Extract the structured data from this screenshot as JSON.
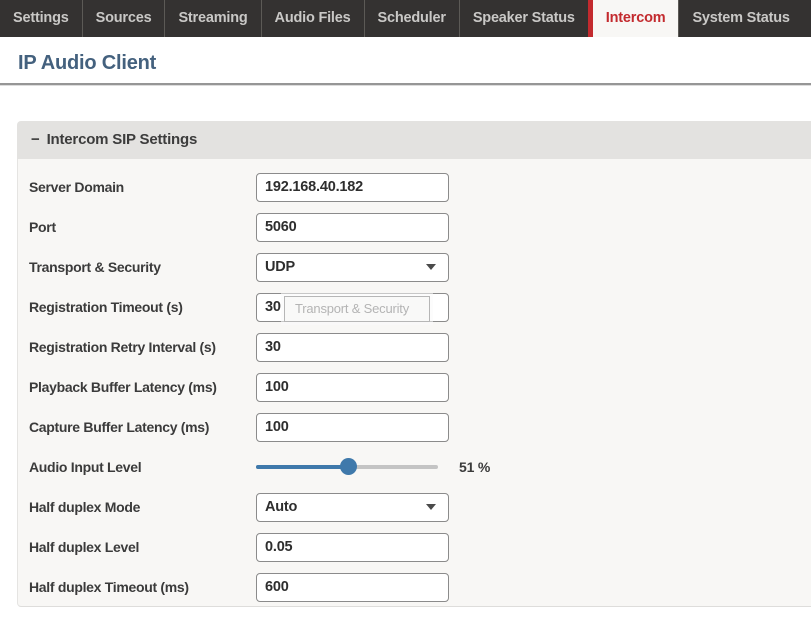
{
  "tabs": [
    {
      "label": "Settings",
      "active": false
    },
    {
      "label": "Sources",
      "active": false
    },
    {
      "label": "Streaming",
      "active": false
    },
    {
      "label": "Audio Files",
      "active": false
    },
    {
      "label": "Scheduler",
      "active": false
    },
    {
      "label": "Speaker Status",
      "active": false
    },
    {
      "label": "Intercom",
      "active": true
    },
    {
      "label": "System Status",
      "active": false
    }
  ],
  "page": {
    "title": "IP Audio Client"
  },
  "panel": {
    "collapse_icon": "−",
    "title": "Intercom SIP Settings",
    "fields": [
      {
        "label": "Server Domain",
        "type": "text",
        "value": "192.168.40.182"
      },
      {
        "label": "Port",
        "type": "text",
        "value": "5060"
      },
      {
        "label": "Transport & Security",
        "type": "select",
        "value": "UDP"
      },
      {
        "label": "Registration Timeout (s)",
        "type": "text",
        "value": "30",
        "tooltip": "Transport & Security"
      },
      {
        "label": "Registration Retry Interval (s)",
        "type": "text",
        "value": "30"
      },
      {
        "label": "Playback Buffer Latency (ms)",
        "type": "text",
        "value": "100"
      },
      {
        "label": "Capture Buffer Latency (ms)",
        "type": "text",
        "value": "100"
      },
      {
        "label": "Audio Input Level",
        "type": "slider",
        "value": 51,
        "display": "51 %"
      },
      {
        "label": "Half duplex Mode",
        "type": "select",
        "value": "Auto"
      },
      {
        "label": "Half duplex Level",
        "type": "text",
        "value": "0.05"
      },
      {
        "label": "Half duplex Timeout (ms)",
        "type": "text",
        "value": "600"
      }
    ]
  },
  "colors": {
    "accent_red": "#c32a2e",
    "slider_blue": "#3f79ab",
    "tab_bar_bg": "#343231",
    "heading_blue": "#44617e",
    "panel_header_bg": "#e3e2e0",
    "panel_body_bg": "#f8f7f5"
  }
}
